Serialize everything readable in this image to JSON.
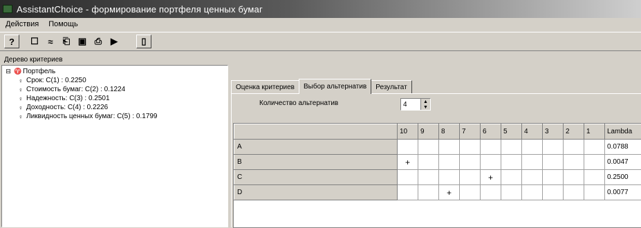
{
  "window": {
    "title": "AssistantChoice - формирование портфеля ценных бумаг"
  },
  "menu": {
    "items": [
      "Действия",
      "Помощь"
    ]
  },
  "toolbar": {
    "buttons": [
      {
        "icon": "help-icon",
        "glyph": "?"
      },
      {
        "icon": "new-icon",
        "glyph": "☐"
      },
      {
        "icon": "equal-icon",
        "glyph": "≈"
      },
      {
        "icon": "table-icon",
        "glyph": "⎗"
      },
      {
        "icon": "save-icon",
        "glyph": "▣"
      },
      {
        "icon": "print-icon",
        "glyph": "⎙"
      },
      {
        "icon": "run-icon",
        "glyph": "▶"
      },
      {
        "icon": "exit-icon",
        "glyph": "▯"
      }
    ]
  },
  "tree": {
    "header": "Дерево критериев",
    "nodes": [
      {
        "text": "Портфель",
        "level": 0
      },
      {
        "text": "Срок: С(1) : 0.2250",
        "level": 1
      },
      {
        "text": "Стоимость бумаг: С(2) : 0.1224",
        "level": 1
      },
      {
        "text": "Надежность: С(3) : 0.2501",
        "level": 1
      },
      {
        "text": "Доходность: С(4) : 0.2226",
        "level": 1
      },
      {
        "text": "Ликвидность ценных бумаг: С(5) : 0.1799",
        "level": 1
      }
    ]
  },
  "tabs": [
    {
      "label": "Оценка критериев",
      "active": false
    },
    {
      "label": "Выбор альтернатив",
      "active": true
    },
    {
      "label": "Результат",
      "active": false
    }
  ],
  "alternatives": {
    "label": "Количество альтернатив",
    "value": "4"
  },
  "grid": {
    "columns": [
      "",
      "10",
      "9",
      "8",
      "7",
      "6",
      "5",
      "4",
      "3",
      "2",
      "1",
      "Lambda"
    ],
    "rows": [
      {
        "name": "A",
        "cells": [
          "",
          "",
          "",
          "",
          "",
          "",
          "",
          "",
          "",
          "",
          "0.0788"
        ]
      },
      {
        "name": "B",
        "cells": [
          "+",
          "",
          "",
          "",
          "",
          "",
          "",
          "",
          "",
          "",
          "0.0047"
        ]
      },
      {
        "name": "C",
        "cells": [
          "",
          "",
          "",
          "",
          "+",
          "",
          "",
          "",
          "",
          "",
          "0.2500"
        ]
      },
      {
        "name": "D",
        "cells": [
          "",
          "",
          "+",
          "",
          "",
          "",
          "",
          "",
          "",
          "",
          "0.0077"
        ]
      }
    ]
  }
}
